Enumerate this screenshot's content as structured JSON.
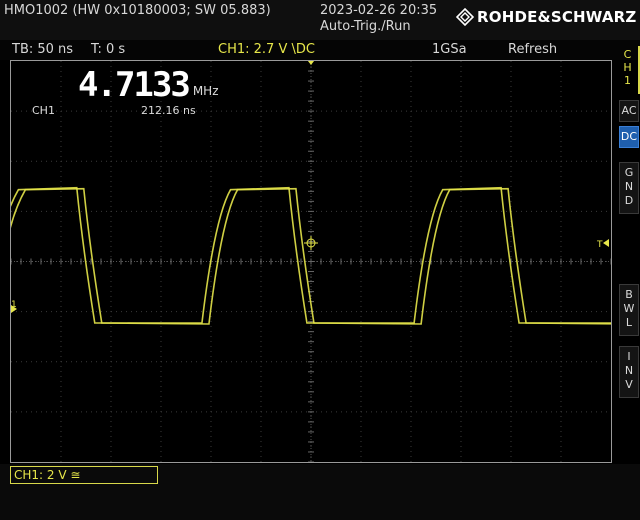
{
  "header": {
    "device_info": "HMO1002 (HW 0x10180003; SW 05.883)",
    "datetime": "2023-02-26 20:35",
    "trigger_mode": "Auto-Trig./Run",
    "brand": "ROHDE&SCHWARZ"
  },
  "status": {
    "timebase": "TB: 50 ns",
    "trigger_time": "T: 0 s",
    "channel_setting": "CH1: 2.7 V \\DC",
    "sample_rate": "1GSa",
    "mode": "Refresh"
  },
  "measurement": {
    "frequency": "4.7133",
    "frequency_unit": "MHz",
    "channel": "CH1",
    "period": "212.16 ns"
  },
  "sidebar": {
    "channel": [
      "C",
      "H",
      "1"
    ],
    "buttons": [
      {
        "label": [
          "A",
          "C"
        ],
        "active": false
      },
      {
        "label": [
          "D",
          "C"
        ],
        "active": true
      },
      {
        "label": [
          "G",
          "N",
          "D"
        ],
        "active": false
      },
      {
        "label": [
          "B",
          "W",
          "L"
        ],
        "active": false
      },
      {
        "label": [
          "I",
          "N",
          "V"
        ],
        "active": false
      }
    ]
  },
  "channel_box": {
    "label": "CH1: 2 V ≅"
  },
  "markers": {
    "ground_marker": "1",
    "trigger_marker": "T"
  },
  "colors": {
    "trace": "#e6e64a",
    "grid": "#3a3a3a",
    "active_button": "#1f5fae"
  },
  "waveform": {
    "period_ns": 212.16,
    "high_v": 5.0,
    "low_v": 0.0,
    "timebase_ns_per_div": 50,
    "volts_per_div": 2
  }
}
